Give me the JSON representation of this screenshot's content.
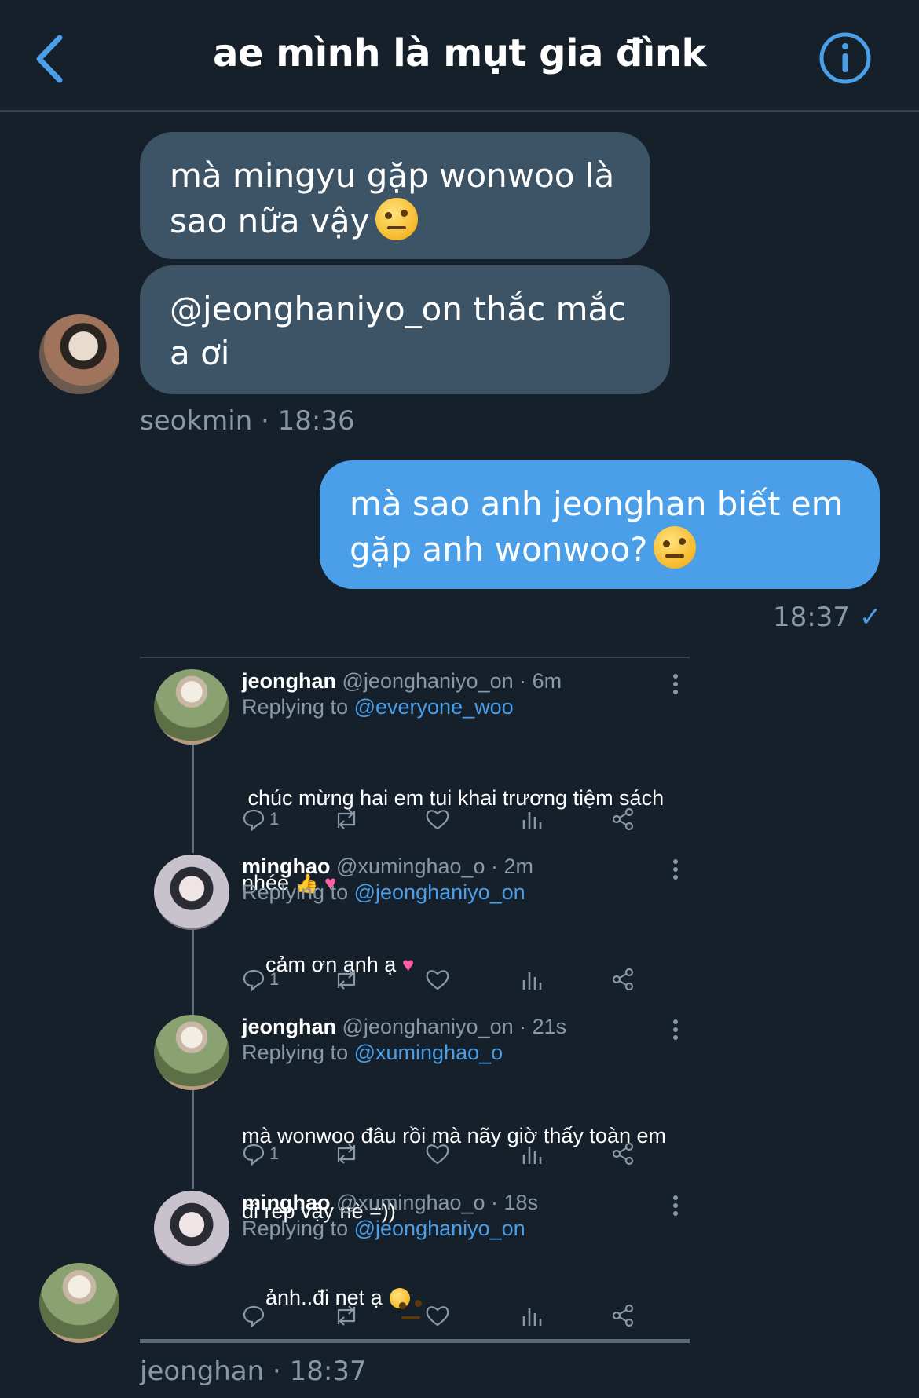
{
  "header": {
    "title": "ae mình là mụt gia đìnk"
  },
  "messages": {
    "in1": "mà mingyu gặp wonwoo là sao nữa vậy",
    "in2_line1": "@jeonghaniyo_on thắc mắc",
    "in2_line2": "a ơi",
    "in_meta": "seokmin · 18:36",
    "out1_line1": "mà sao anh jeonghan biết em",
    "out1_line2": "gặp anh wonwoo?",
    "out_time": "18:37",
    "shared_meta": "jeonghan · 18:37"
  },
  "thread": [
    {
      "name": "jeonghan",
      "handle_time": "@jeonghaniyo_on · 6m",
      "reply_prefix": "Replying to",
      "reply_to": "@everyone_woo",
      "text_line1": " chúc mừng hai em tui khai trương tiệm sách",
      "text_line2": "nhée",
      "reply_count": "1"
    },
    {
      "name": "minghao",
      "handle_time": "@xuminghao_o · 2m",
      "reply_prefix": "Replying to",
      "reply_to": "@jeonghaniyo_on",
      "text_line1": "cảm ơn anh ạ",
      "reply_count": "1"
    },
    {
      "name": "jeonghan",
      "handle_time": "@jeonghaniyo_on · 21s",
      "reply_prefix": "Replying to",
      "reply_to": "@xuminghao_o",
      "text_line1": "mà wonwoo đâu rồi mà nãy giờ thấy toàn em",
      "text_line2": "đi rep vậy nè =))",
      "reply_count": "1"
    },
    {
      "name": "minghao",
      "handle_time": "@xuminghao_o · 18s",
      "reply_prefix": "Replying to",
      "reply_to": "@jeonghaniyo_on",
      "text_line1": "ảnh..đi net ạ",
      "reply_count": ""
    }
  ],
  "colors": {
    "background": "#15202b",
    "incoming": "#3d5466",
    "outgoing": "#4a9fe8",
    "accent": "#4a9fe8",
    "muted": "#8899a6"
  },
  "icons": [
    "back-chevron-icon",
    "info-icon",
    "reply-icon",
    "retweet-icon",
    "like-icon",
    "analytics-icon",
    "share-icon",
    "more-options-icon"
  ]
}
